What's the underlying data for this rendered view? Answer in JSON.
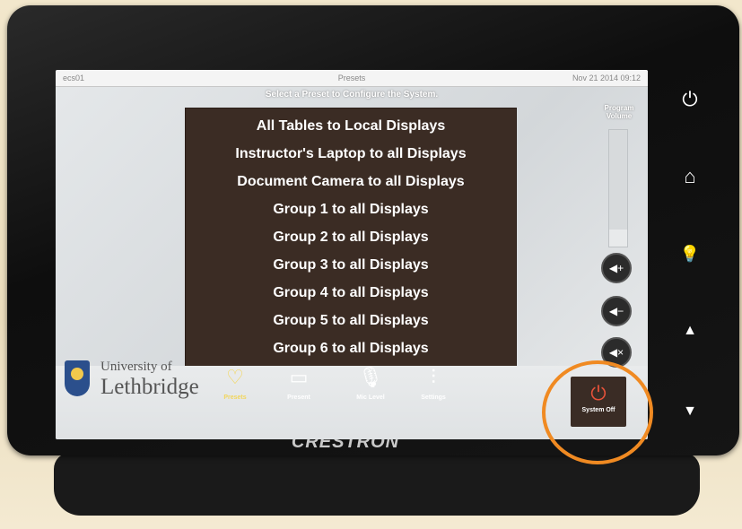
{
  "device": {
    "brand": "CRESTRON",
    "hardware_buttons": [
      {
        "name": "power-icon",
        "glyph": "⏻"
      },
      {
        "name": "home-icon",
        "glyph": "⌂"
      },
      {
        "name": "lightbulb-icon",
        "glyph": "💡"
      },
      {
        "name": "up-arrow-icon",
        "glyph": "▲"
      },
      {
        "name": "down-arrow-icon",
        "glyph": "▼"
      }
    ]
  },
  "status_bar": {
    "left": "ecs01",
    "title": "Presets",
    "datetime": "Nov 21 2014 09:12"
  },
  "instruction": "Select a Preset to Configure the System.",
  "presets": [
    "All Tables to Local Displays",
    "Instructor's Laptop to all Displays",
    "Document Camera to all Displays",
    "Group 1 to all Displays",
    "Group 2 to all Displays",
    "Group 3 to all Displays",
    "Group 4 to all Displays",
    "Group 5 to all Displays",
    "Group 6 to all Displays"
  ],
  "volume": {
    "label": "Program Volume",
    "level": 0.15,
    "buttons": [
      {
        "name": "volume-up-button",
        "glyph": "◀+"
      },
      {
        "name": "volume-down-button",
        "glyph": "◀−"
      },
      {
        "name": "mute-button",
        "glyph": "◀×"
      }
    ]
  },
  "logo": {
    "line1": "University of",
    "line2": "Lethbridge"
  },
  "nav": [
    {
      "label": "Presets",
      "icon": "heart-icon",
      "glyph": "♡",
      "active": true
    },
    {
      "label": "Present",
      "icon": "display-icon",
      "glyph": "▭",
      "active": false
    },
    {
      "label": "Mic Level",
      "icon": "microphone-icon",
      "glyph": "🎙",
      "active": false
    },
    {
      "label": "Settings",
      "icon": "sliders-icon",
      "glyph": "⫶",
      "active": false
    }
  ],
  "system_off": {
    "label": "System Off",
    "glyph": "⏻"
  },
  "colors": {
    "accent_highlight": "#f08a22",
    "preset_panel": "#3b2c24",
    "active_nav": "#f2d65c",
    "power_red": "#e6523a"
  }
}
